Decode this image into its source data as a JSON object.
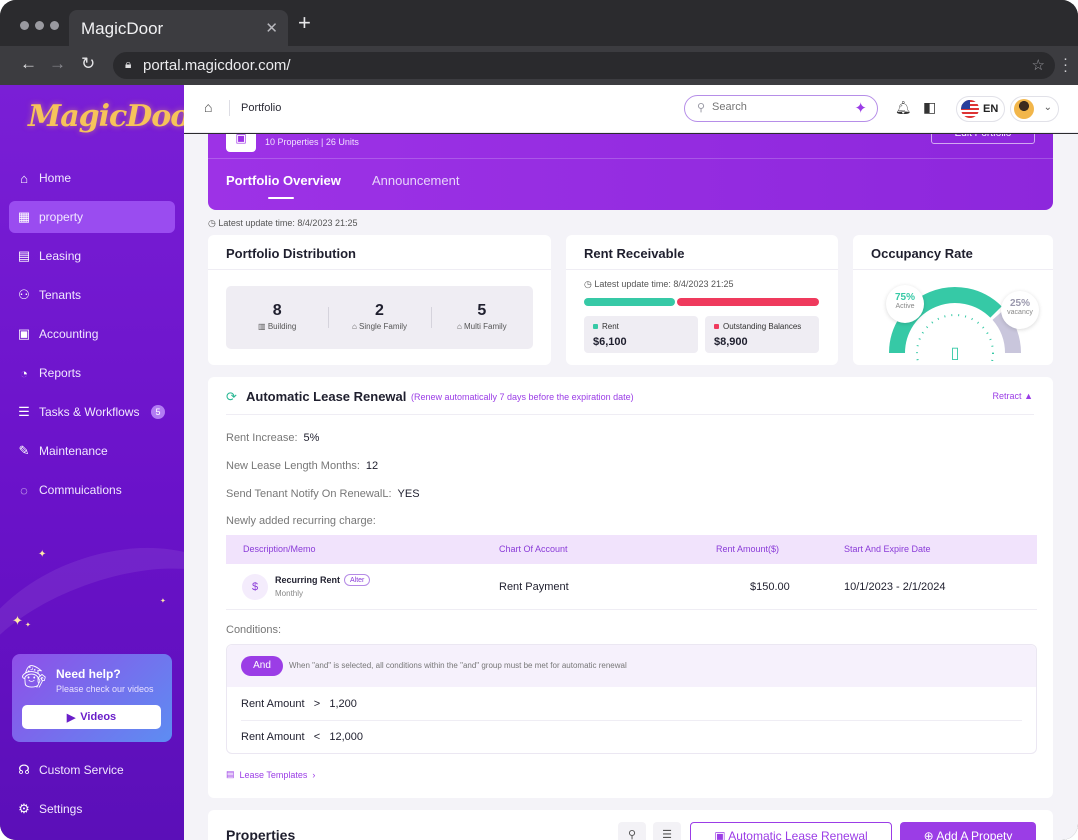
{
  "browser": {
    "tab_title": "MagicDoor",
    "url": "portal.magicdoor.com/"
  },
  "sidebar": {
    "logo": "MagicDoor",
    "items": [
      {
        "label": "Home",
        "icon": "home-icon"
      },
      {
        "label": "property",
        "icon": "building-icon",
        "active": true
      },
      {
        "label": "Leasing",
        "icon": "document-icon"
      },
      {
        "label": "Tenants",
        "icon": "users-icon"
      },
      {
        "label": "Accounting",
        "icon": "wallet-icon"
      },
      {
        "label": "Reports",
        "icon": "pie-chart-icon"
      },
      {
        "label": "Tasks & Workflows",
        "icon": "tasks-icon",
        "badge": "5"
      },
      {
        "label": "Maintenance",
        "icon": "wrench-icon"
      },
      {
        "label": "Commuications",
        "icon": "chat-icon"
      }
    ],
    "help": {
      "title": "Need help?",
      "subtitle": "Please check our videos",
      "button": "Videos"
    },
    "bottom_items": [
      {
        "label": "Custom Service",
        "icon": "headset-icon"
      },
      {
        "label": "Settings",
        "icon": "gear-icon"
      }
    ]
  },
  "header": {
    "breadcrumb": "Portfolio",
    "search_placeholder": "Search",
    "language": "EN"
  },
  "portfolio": {
    "meta": "10 Properties | 26 Units",
    "edit_button": "Edit Portfolio",
    "tabs": [
      "Portfolio Overview",
      "Announcement"
    ],
    "update_time": "Latest update time: 8/4/2023 21:25"
  },
  "distribution": {
    "title": "Portfolio Distribution",
    "items": [
      {
        "value": "8",
        "label": "Building"
      },
      {
        "value": "2",
        "label": "Single Family"
      },
      {
        "value": "5",
        "label": "Multi Family"
      }
    ]
  },
  "rent": {
    "title": "Rent Receivable",
    "update_time": "Latest update time: 8/4/2023 21:25",
    "rent_label": "Rent",
    "rent_value": "$6,100",
    "outstanding_label": "Outstanding Balances",
    "outstanding_value": "$8,900",
    "colors": {
      "rent": "#36c9a6",
      "outstanding": "#ef3a5d"
    }
  },
  "occupancy": {
    "title": "Occupancy Rate",
    "active_pct": "75%",
    "active_label": "Active",
    "vacancy_pct": "25%",
    "vacancy_label": "vacancy",
    "active_fraction": 0.75,
    "colors": {
      "active": "#36c9a6",
      "vacancy": "#c9c6dc"
    }
  },
  "renewal": {
    "title": "Automatic Lease Renewal",
    "subtitle": "(Renew automatically 7 days before the expiration date)",
    "retract": "Retract",
    "fields": [
      {
        "label": "Rent Increase:",
        "value": "5%"
      },
      {
        "label": "New Lease Length Months:",
        "value": "12"
      },
      {
        "label": "Send Tenant Notify On RenewalL:",
        "value": "YES"
      }
    ],
    "recurring_label": "Newly added recurring charge:",
    "table": {
      "headers": [
        "Description/Memo",
        "Chart Of Account",
        "Rent Amount($)",
        "Start And Expire Date"
      ],
      "row": {
        "title": "Recurring Rent",
        "tag": "Alter",
        "frequency": "Monthly",
        "account": "Rent Payment",
        "amount": "$150.00",
        "dates": "10/1/2023 - 2/1/2024"
      }
    },
    "conditions_label": "Conditions:",
    "and_label": "And",
    "and_note": "When \"and\" is selected, all conditions within the \"and\" group must be met for automatic renewal",
    "conditions": [
      {
        "field": "Rent Amount",
        "op": ">",
        "value": "1,200"
      },
      {
        "field": "Rent Amount",
        "op": "<",
        "value": "12,000"
      }
    ],
    "templates_link": "Lease Templates"
  },
  "properties": {
    "title": "Properties",
    "renewal_button": "Automatic Lease Renewal",
    "add_button": "Add A Propety"
  }
}
